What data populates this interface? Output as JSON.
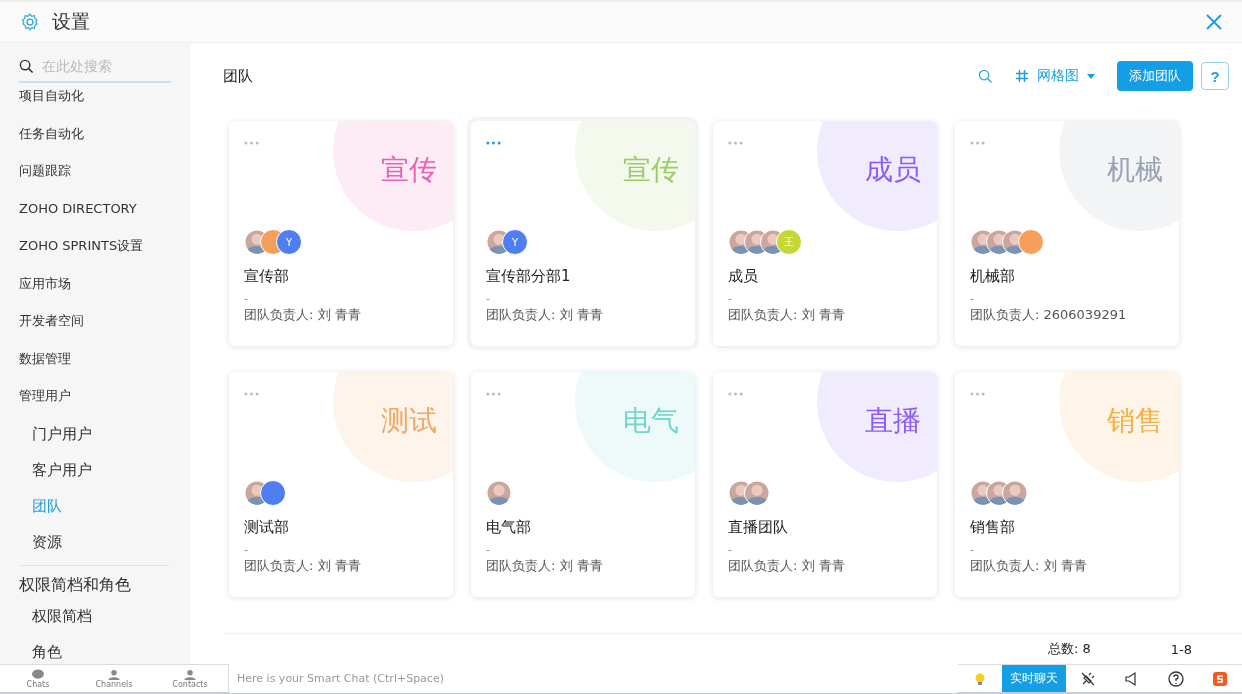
{
  "window": {
    "title": "设置"
  },
  "sidebar": {
    "search": {
      "placeholder": "在此处搜索"
    },
    "items": [
      {
        "label": "项目自动化",
        "selected": false
      },
      {
        "label": "任务自动化",
        "selected": false
      },
      {
        "label": "问题跟踪",
        "selected": false
      },
      {
        "label": "ZOHO DIRECTORY",
        "selected": false
      },
      {
        "label": "ZOHO SPRINTS设置",
        "selected": false
      },
      {
        "label": "应用市场",
        "selected": false
      },
      {
        "label": "开发者空间",
        "selected": false
      },
      {
        "label": "数据管理",
        "selected": false
      },
      {
        "label": "管理用户",
        "selected": false,
        "children": [
          {
            "label": "门户用户",
            "selected": false
          },
          {
            "label": "客户用户",
            "selected": false
          },
          {
            "label": "团队",
            "selected": true
          },
          {
            "label": "资源",
            "selected": false
          }
        ]
      },
      {
        "label": "权限简档和角色",
        "kind": "group",
        "selected": false,
        "children": [
          {
            "label": "权限简档",
            "selected": false
          },
          {
            "label": "角色",
            "selected": false
          }
        ]
      }
    ]
  },
  "main": {
    "title": "团队",
    "view": "网格图",
    "add_button": "添加团队",
    "help_button": "?",
    "teams": [
      {
        "badge": "宣传",
        "color": "#ec5fb4",
        "name": "宣传部",
        "description": "-",
        "lead": "团队负责人: 刘 青青",
        "selected": false,
        "avatars": [
          {
            "kind": "photo"
          },
          {
            "kind": "initial",
            "color": "#f5a05a"
          },
          {
            "kind": "initial",
            "color": "#4f7ef0",
            "letter": "Y"
          }
        ]
      },
      {
        "badge": "宣传",
        "color": "#9ccc65",
        "name": "宣传部分部1",
        "description": "-",
        "lead": "团队负责人: 刘 青青",
        "selected": true,
        "avatars": [
          {
            "kind": "photo"
          },
          {
            "kind": "initial",
            "color": "#4f7ef0",
            "letter": "Y"
          }
        ]
      },
      {
        "badge": "成员",
        "color": "#8b5cf6",
        "name": "成员",
        "description": "-",
        "lead": "团队负责人: 刘 青青",
        "selected": false,
        "avatars": [
          {
            "kind": "photo"
          },
          {
            "kind": "photo"
          },
          {
            "kind": "photo"
          },
          {
            "kind": "initial",
            "color": "#c6d635",
            "letter": "王"
          }
        ]
      },
      {
        "badge": "机械",
        "color": "#9aa3b5",
        "name": "机械部",
        "description": "-",
        "lead": "团队负责人: 2606039291",
        "selected": false,
        "avatars": [
          {
            "kind": "photo"
          },
          {
            "kind": "photo"
          },
          {
            "kind": "photo"
          },
          {
            "kind": "initial",
            "color": "#f5a05a"
          }
        ]
      },
      {
        "badge": "测试",
        "color": "#f0a860",
        "name": "测试部",
        "description": "-",
        "lead": "团队负责人: 刘 青青",
        "selected": false,
        "avatars": [
          {
            "kind": "photo"
          },
          {
            "kind": "initial",
            "color": "#4f7ef0"
          }
        ]
      },
      {
        "badge": "电气",
        "color": "#6fd6cf",
        "name": "电气部",
        "description": "-",
        "lead": "团队负责人: 刘 青青",
        "selected": false,
        "avatars": [
          {
            "kind": "photo"
          }
        ]
      },
      {
        "badge": "直播",
        "color": "#8b5cf6",
        "name": "直播团队",
        "description": "-",
        "lead": "团队负责人: 刘 青青",
        "selected": false,
        "avatars": [
          {
            "kind": "photo"
          },
          {
            "kind": "photo"
          }
        ]
      },
      {
        "badge": "销售",
        "color": "#f5b041",
        "name": "销售部",
        "description": "-",
        "lead": "团队负责人: 刘 青青",
        "selected": false,
        "avatars": [
          {
            "kind": "photo"
          },
          {
            "kind": "photo"
          },
          {
            "kind": "photo"
          }
        ]
      }
    ],
    "pager": {
      "total": "总数: 8",
      "range": "1-8"
    }
  },
  "chat_bar": {
    "tabs": [
      {
        "label": "Chats"
      },
      {
        "label": "Channels"
      },
      {
        "label": "Contacts"
      }
    ],
    "placeholder": "Here is your Smart Chat (Ctrl+Space)",
    "live_chat": "实时聊天"
  }
}
